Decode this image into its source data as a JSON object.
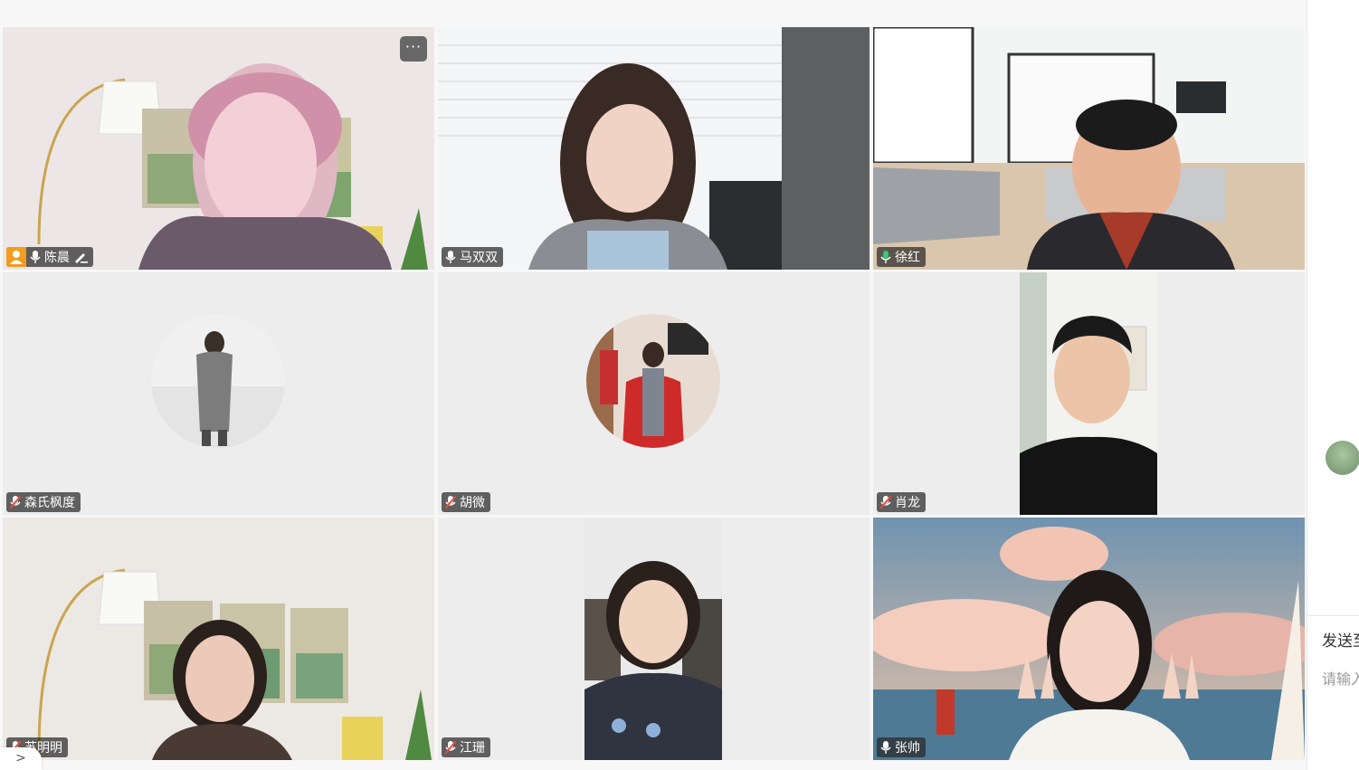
{
  "meeting": {
    "participants": [
      {
        "name": "陈晨",
        "mic": "on",
        "host": true,
        "editing": true,
        "video": "camera",
        "active": true
      },
      {
        "name": "马双双",
        "mic": "on",
        "video": "camera"
      },
      {
        "name": "徐红",
        "mic": "speaking",
        "video": "camera"
      },
      {
        "name": "森氏枫度",
        "mic": "muted",
        "video": "avatar"
      },
      {
        "name": "胡微",
        "mic": "muted",
        "video": "avatar"
      },
      {
        "name": "肖龙",
        "mic": "muted",
        "video": "camera"
      },
      {
        "name": "苏明明",
        "mic": "muted",
        "video": "camera"
      },
      {
        "name": "江珊",
        "mic": "muted",
        "video": "camera"
      },
      {
        "name": "张帅",
        "mic": "on",
        "video": "camera"
      }
    ],
    "more_label": "···"
  },
  "right_panel": {
    "send_to": "发送至",
    "input_placeholder": "请输入"
  },
  "bottom_toggle": ">",
  "colors": {
    "active_border": "#2ecc8a",
    "host_badge": "#f39c1f",
    "muted_icon": "#e74c3c",
    "speaking_icon": "#2ecc71"
  }
}
